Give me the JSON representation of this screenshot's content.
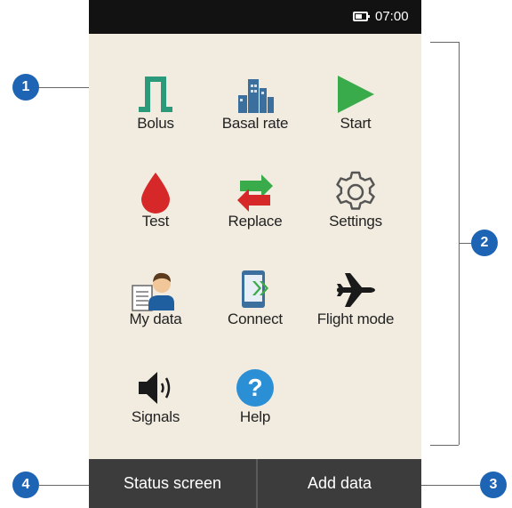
{
  "status_bar": {
    "time": "07:00"
  },
  "menu": {
    "items": [
      {
        "label": "Bolus",
        "icon": "bolus-icon"
      },
      {
        "label": "Basal rate",
        "icon": "basal-rate-icon"
      },
      {
        "label": "Start",
        "icon": "play-icon"
      },
      {
        "label": "Test",
        "icon": "blood-drop-icon"
      },
      {
        "label": "Replace",
        "icon": "replace-arrows-icon"
      },
      {
        "label": "Settings",
        "icon": "gear-icon"
      },
      {
        "label": "My data",
        "icon": "my-data-icon"
      },
      {
        "label": "Connect",
        "icon": "connect-icon"
      },
      {
        "label": "Flight mode",
        "icon": "airplane-icon"
      },
      {
        "label": "Signals",
        "icon": "speaker-icon"
      },
      {
        "label": "Help",
        "icon": "help-icon"
      }
    ]
  },
  "bottom_bar": {
    "left_label": "Status screen",
    "right_label": "Add data"
  },
  "callouts": {
    "c1": "1",
    "c2": "2",
    "c3": "3",
    "c4": "4"
  },
  "colors": {
    "bolus": "#2a9a7a",
    "basal": "#3b6f9e",
    "start": "#3aab4a",
    "drop": "#d62828",
    "replace_green": "#3aab4a",
    "replace_red": "#d62828",
    "help": "#2b8fd6",
    "callout": "#1e64b4"
  }
}
